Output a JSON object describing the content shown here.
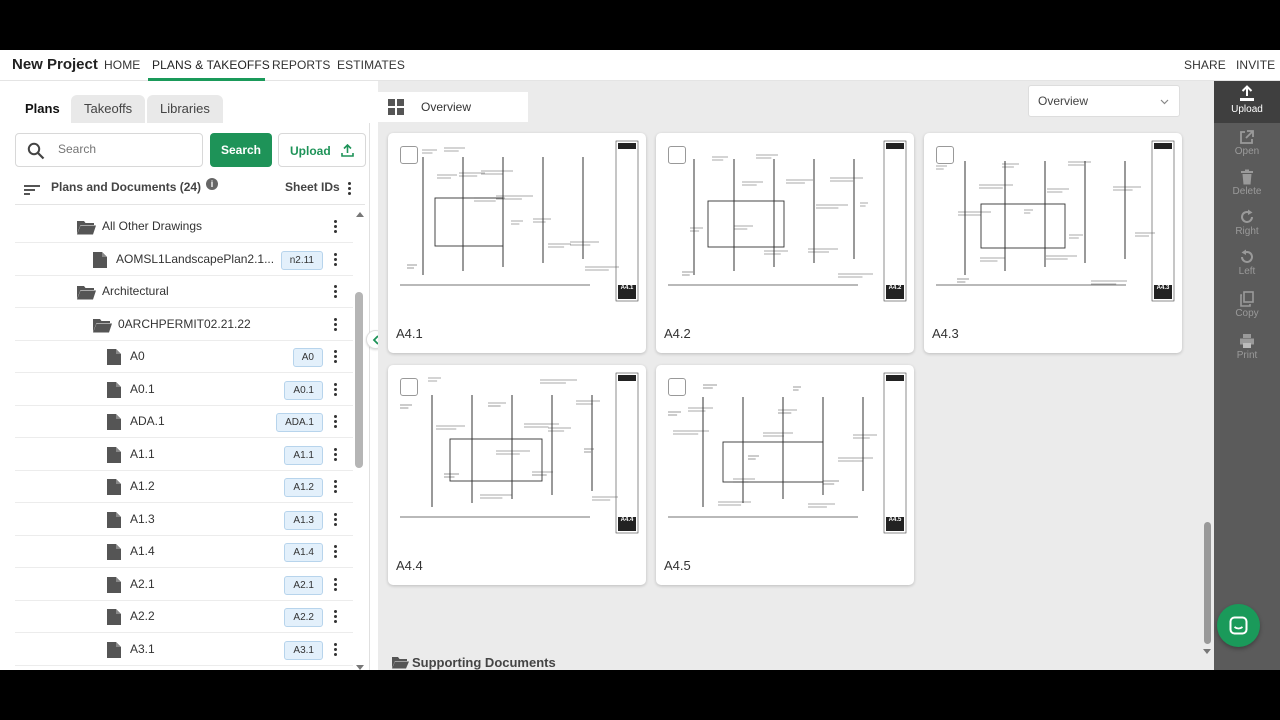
{
  "project_title": "New Project",
  "nav": {
    "home": "HOME",
    "plans": "PLANS & TAKEOFFS",
    "reports": "REPORTS",
    "estimates": "ESTIMATES",
    "share": "SHARE",
    "invite": "INVITE"
  },
  "left_tabs": {
    "plans": "Plans",
    "takeoffs": "Takeoffs",
    "libraries": "Libraries"
  },
  "search": {
    "placeholder": "Search",
    "button": "Search",
    "upload": "Upload"
  },
  "tree_header": {
    "title": "Plans and Documents (24)",
    "sheet_ids": "Sheet IDs"
  },
  "tree": {
    "rows": [
      {
        "type": "folder",
        "label": "All Other Drawings",
        "badge": ""
      },
      {
        "type": "file",
        "label": "AOMSL1LandscapePlan2.1...",
        "badge": "n2.11"
      },
      {
        "type": "folder",
        "label": "Architectural",
        "badge": ""
      },
      {
        "type": "folder",
        "label": "0ARCHPERMIT02.21.22",
        "badge": ""
      },
      {
        "type": "file",
        "label": "A0",
        "badge": "A0"
      },
      {
        "type": "file",
        "label": "A0.1",
        "badge": "A0.1"
      },
      {
        "type": "file",
        "label": "ADA.1",
        "badge": "ADA.1"
      },
      {
        "type": "file",
        "label": "A1.1",
        "badge": "A1.1"
      },
      {
        "type": "file",
        "label": "A1.2",
        "badge": "A1.2"
      },
      {
        "type": "file",
        "label": "A1.3",
        "badge": "A1.3"
      },
      {
        "type": "file",
        "label": "A1.4",
        "badge": "A1.4"
      },
      {
        "type": "file",
        "label": "A2.1",
        "badge": "A2.1"
      },
      {
        "type": "file",
        "label": "A2.2",
        "badge": "A2.2"
      },
      {
        "type": "file",
        "label": "A3.1",
        "badge": "A3.1"
      }
    ]
  },
  "main": {
    "overview_tab": "Overview",
    "view_select": "Overview",
    "cards": [
      {
        "title": "A4.1",
        "stamp": "A4.1"
      },
      {
        "title": "A4.2",
        "stamp": "A4.2"
      },
      {
        "title": "A4.3",
        "stamp": "A4.3"
      },
      {
        "title": "A4.4",
        "stamp": "A4.4"
      },
      {
        "title": "A4.5",
        "stamp": "A4.5"
      }
    ],
    "supporting_docs": "Supporting Documents"
  },
  "right_toolbar": {
    "upload": "Upload",
    "open": "Open",
    "delete": "Delete",
    "right": "Right",
    "left": "Left",
    "copy": "Copy",
    "print": "Print"
  },
  "colors": {
    "accent_green": "#1e9358",
    "toolbar_bg": "#5b5b5b",
    "badge_bg": "#e3f0fb"
  }
}
